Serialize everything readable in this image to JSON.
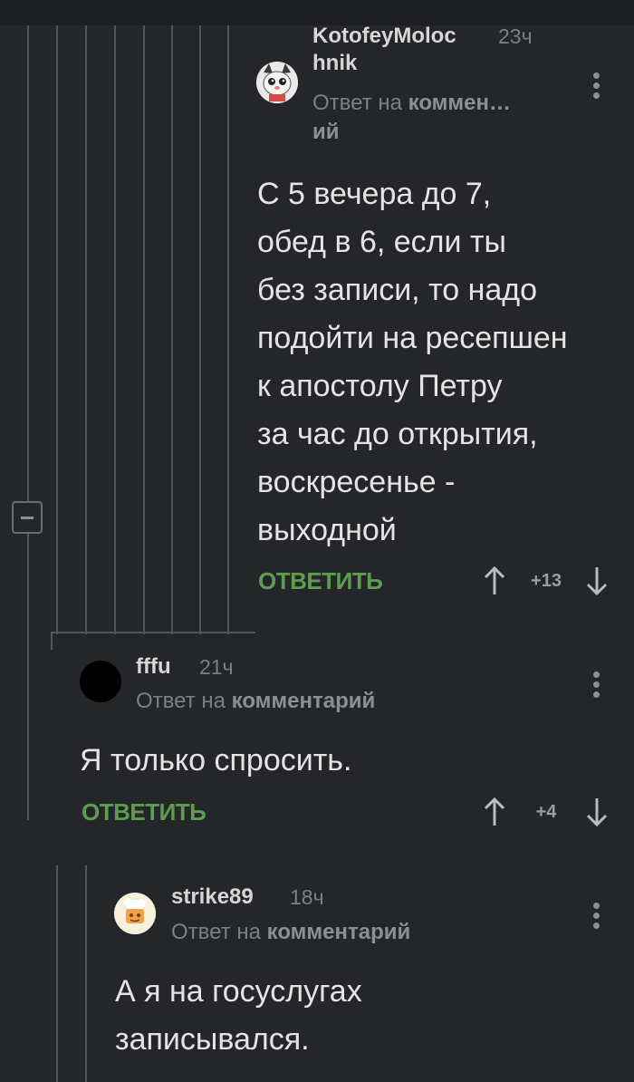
{
  "comments": [
    {
      "author_line1": "KotofeyMoloc",
      "author_line2": "hnik",
      "time": "23ч",
      "reply_prefix": "Ответ на",
      "reply_target_line1": "коммен…",
      "reply_target_line2": "ий",
      "text_lines": [
        "С 5 вечера до 7,",
        "обед в 6, если ты",
        "без записи, то надо",
        "подойти на ресепшен",
        "к апостолу Петру",
        "за час до открытия,",
        "воскресенье -",
        "выходной"
      ],
      "reply_label": "ОТВЕТИТЬ",
      "rating": "+13",
      "avatar_icon": "cat-avatar-icon"
    },
    {
      "author": "fffu",
      "time": "21ч",
      "reply_prefix": "Ответ на",
      "reply_target": "комментарий",
      "text_lines": [
        "Я только спросить."
      ],
      "reply_label": "ОТВЕТИТЬ",
      "rating": "+4",
      "avatar_icon": "black-circle-avatar"
    },
    {
      "author": "strike89",
      "time": "18ч",
      "reply_prefix": "Ответ на",
      "reply_target": "комментарий",
      "text_lines": [
        "А я на госуслугах",
        "записывался."
      ],
      "avatar_icon": "chef-avatar-icon"
    }
  ],
  "colors": {
    "background": "#24262a",
    "accent_green": "#5e9d4e",
    "muted_text": "#7c8085",
    "thread_line": "#53565b"
  },
  "icons": {
    "upvote": "arrow-up-icon",
    "downvote": "arrow-down-icon",
    "menu": "kebab-menu-icon",
    "collapse": "collapse-thread-icon"
  }
}
